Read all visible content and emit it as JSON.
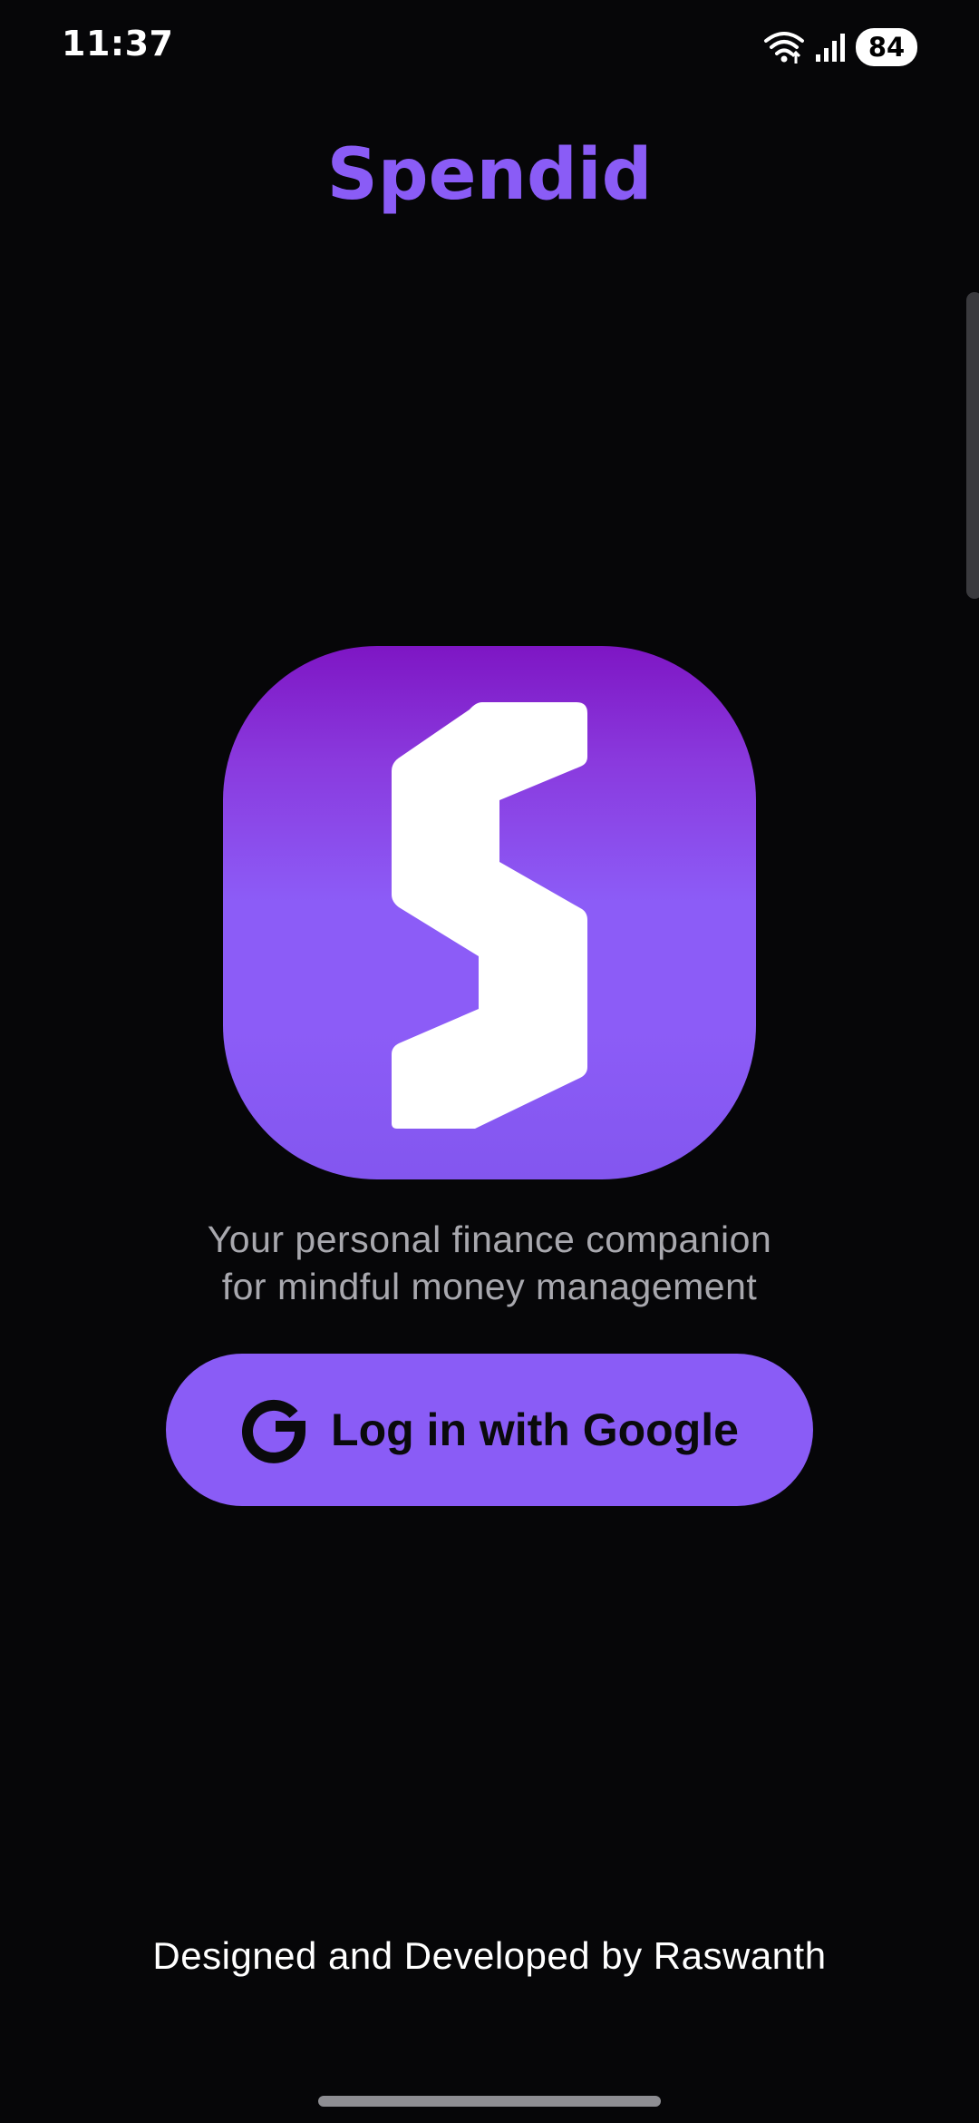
{
  "status_bar": {
    "time": "11:37",
    "battery": "84",
    "icons": [
      "wifi-icon",
      "signal-icon"
    ]
  },
  "app": {
    "title": "Spendid",
    "logo_icon": "spendid-s-logo-icon"
  },
  "tagline": {
    "line1": "Your personal finance companion",
    "line2": "for mindful money management"
  },
  "login": {
    "button_label": "Log in with Google",
    "icon": "google-icon"
  },
  "footer": {
    "credit": "Designed and Developed by Raswanth"
  },
  "colors": {
    "background": "#060608",
    "accent": "#8a5cf6",
    "logo_gradient_top": "#7e16c4",
    "logo_gradient_bottom": "#8356ef",
    "tagline_text": "#a8a8ae"
  }
}
